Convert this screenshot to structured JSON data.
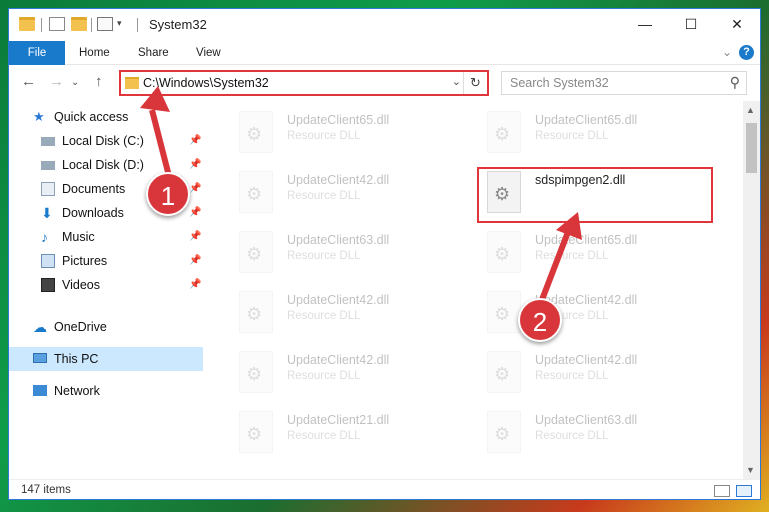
{
  "window": {
    "title": "System32"
  },
  "ribbon": {
    "tabs": [
      "File",
      "Home",
      "Share",
      "View"
    ],
    "help": "?"
  },
  "nav": {
    "address": "C:\\Windows\\System32",
    "search_placeholder": "Search System32"
  },
  "sidebar": {
    "items": [
      {
        "label": "Quick access",
        "icon": "star-icon",
        "pinned": false
      },
      {
        "label": "Local Disk (C:)",
        "icon": "drive-icon",
        "pinned": true
      },
      {
        "label": "Local Disk (D:)",
        "icon": "drive-icon",
        "pinned": true
      },
      {
        "label": "Documents",
        "icon": "documents-icon",
        "pinned": true
      },
      {
        "label": "Downloads",
        "icon": "download-icon",
        "pinned": true
      },
      {
        "label": "Music",
        "icon": "music-icon",
        "pinned": true
      },
      {
        "label": "Pictures",
        "icon": "pictures-icon",
        "pinned": true
      },
      {
        "label": "Videos",
        "icon": "videos-icon",
        "pinned": true
      },
      {
        "label": "OneDrive",
        "icon": "cloud-icon",
        "pinned": false
      },
      {
        "label": "This PC",
        "icon": "computer-icon",
        "pinned": false,
        "selected": true
      },
      {
        "label": "Network",
        "icon": "network-icon",
        "pinned": false
      }
    ]
  },
  "files": [
    {
      "name": "UpdateClient65.dll",
      "type": "Resource DLL"
    },
    {
      "name": "UpdateClient65.dll",
      "type": "Resource DLL"
    },
    {
      "name": "UpdateClient42.dll",
      "type": "Resource DLL"
    },
    {
      "name": "sdspimpgen2.dll",
      "type": "",
      "highlighted": true
    },
    {
      "name": "UpdateClient63.dll",
      "type": "Resource DLL"
    },
    {
      "name": "UpdateClient65.dll",
      "type": "Resource DLL"
    },
    {
      "name": "UpdateClient42.dll",
      "type": "Resource DLL"
    },
    {
      "name": "UpdateClient42.dll",
      "type": "Resource DLL"
    },
    {
      "name": "UpdateClient42.dll",
      "type": "Resource DLL"
    },
    {
      "name": "UpdateClient42.dll",
      "type": "Resource DLL"
    },
    {
      "name": "UpdateClient21.dll",
      "type": "Resource DLL"
    },
    {
      "name": "UpdateClient63.dll",
      "type": "Resource DLL"
    }
  ],
  "status": {
    "count": "147 items"
  },
  "callouts": [
    "1",
    "2"
  ],
  "colors": {
    "accent": "#1979ca",
    "highlight": "#e0353a",
    "selected": "#cce8ff"
  }
}
